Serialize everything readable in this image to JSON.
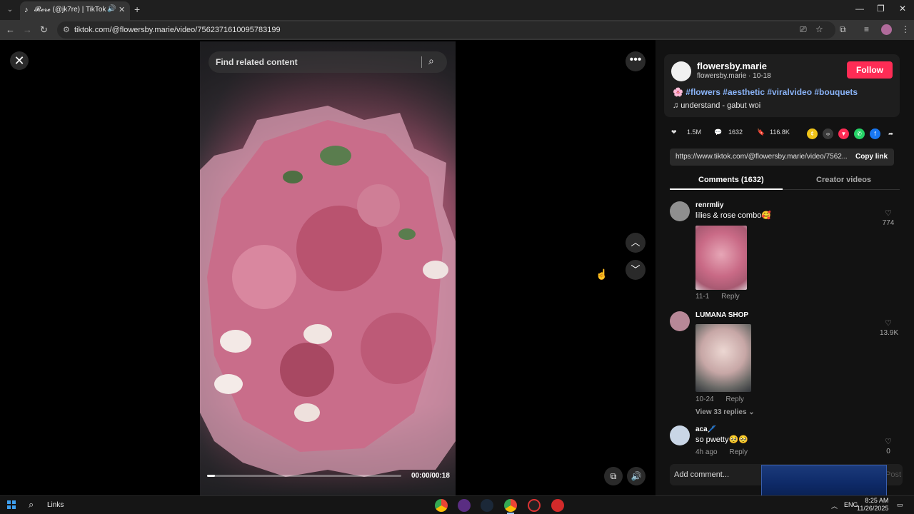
{
  "browser": {
    "tab_title": "𝓡𝓮𝓻𝓮 (@jk7re) | TikTok",
    "tab_audio_icon": "speaker-icon",
    "url": "tiktok.com/@flowersby.marie/video/7562371610095783199"
  },
  "video": {
    "search_placeholder": "Find related content",
    "time": "00:00/00:18",
    "progress_fraction": 0.04
  },
  "author": {
    "username": "flowersby.marie",
    "subline": "flowersby.marie · 10-18",
    "follow_label": "Follow",
    "hashtags": "🌸 #flowers #aesthetic #viralvideo #bouquets",
    "music": "♫  understand - gabut woi"
  },
  "stats": {
    "likes": "1.5M",
    "comments": "1632",
    "saves": "116.8K"
  },
  "link": {
    "url": "https://www.tiktok.com/@flowersby.marie/video/7562...",
    "copy_label": "Copy link"
  },
  "panel_tabs": {
    "comments": "Comments (1632)",
    "creator": "Creator videos"
  },
  "comments": [
    {
      "name": "renrmliy",
      "text": "lilies & rose combo🥰",
      "date": "11-1",
      "reply": "Reply",
      "likes": "774"
    },
    {
      "name": "LUMANA SHOP",
      "text": "",
      "date": "10-24",
      "reply": "Reply",
      "likes": "13.9K",
      "replies": "View 33 replies ⌄"
    },
    {
      "name": "aca🖊️",
      "text": "so pwetty🥺🥺",
      "date": "4h ago",
      "reply": "Reply",
      "likes": "0"
    }
  ],
  "add_comment": {
    "placeholder": "Add comment...",
    "post": "Post"
  },
  "taskbar": {
    "links_label": "Links",
    "lang": "ENG",
    "time": "8:25 AM",
    "date": "11/26/2025"
  },
  "colors": {
    "follow": "#fe2c55",
    "hashtag": "#8ab4f8"
  }
}
